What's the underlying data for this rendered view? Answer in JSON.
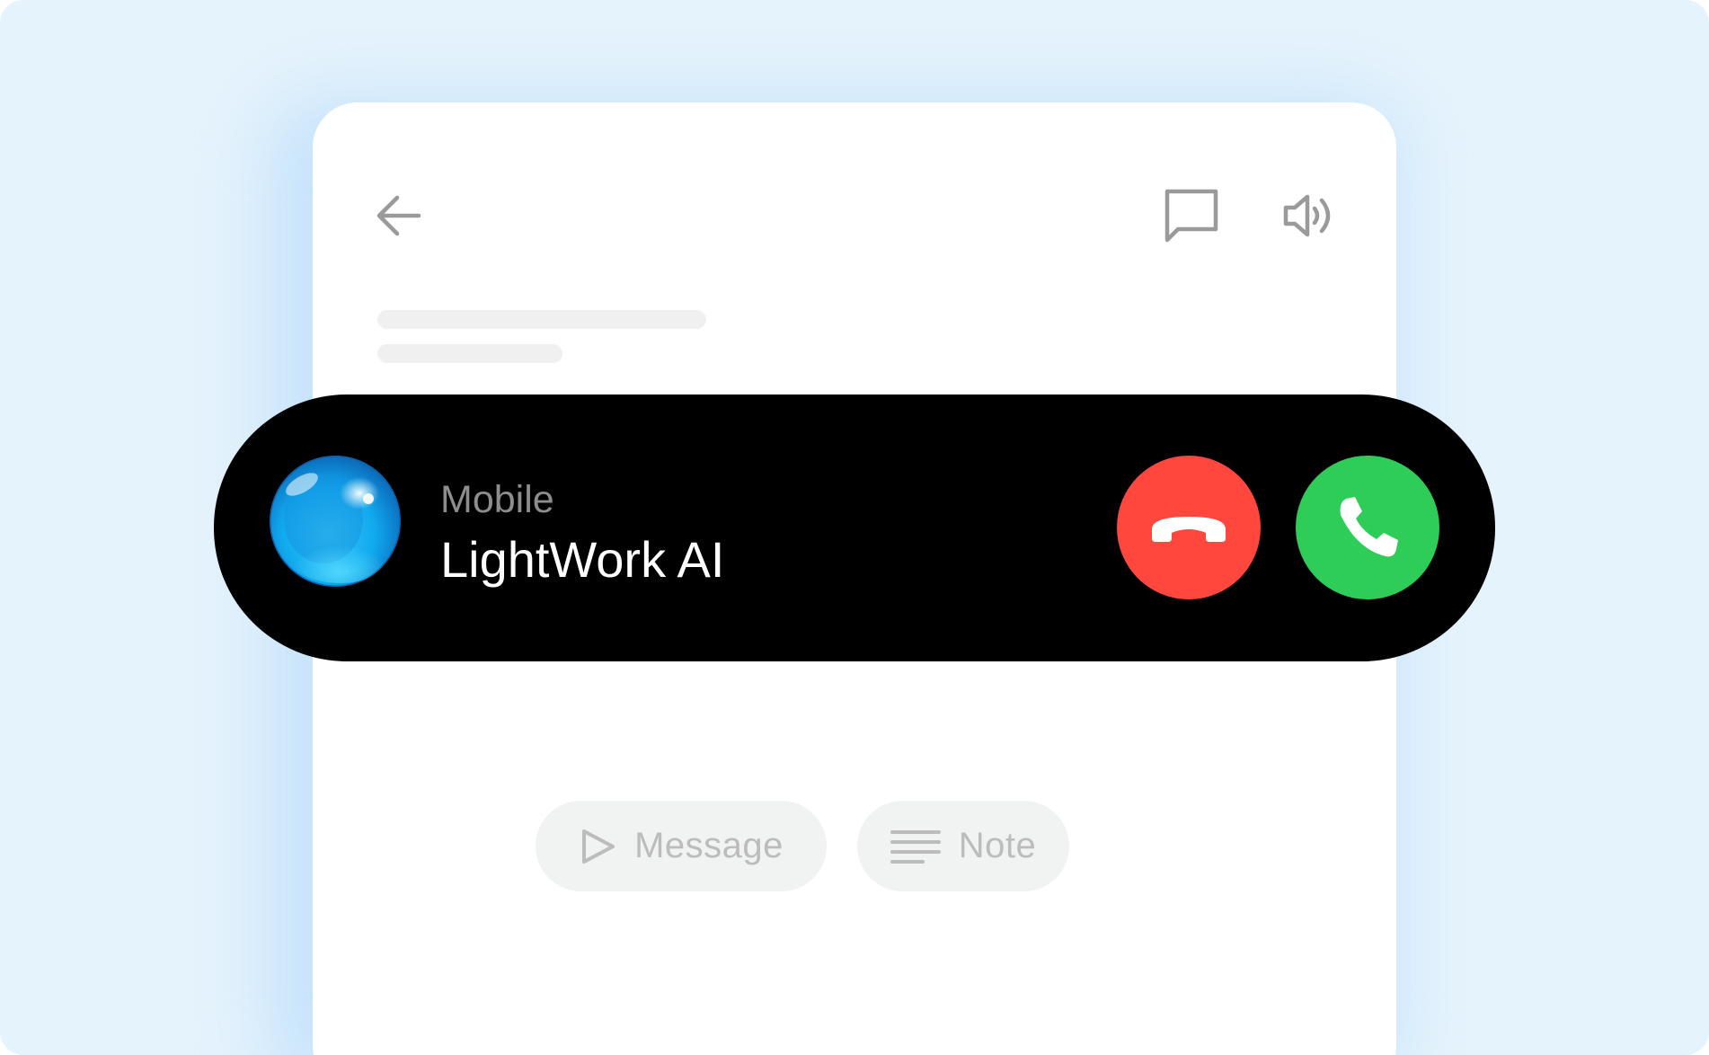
{
  "header": {
    "back_icon": "arrow-left-icon",
    "chat_icon": "chat-bubble-icon",
    "speaker_icon": "speaker-icon"
  },
  "incoming_call": {
    "line_label": "Mobile",
    "caller_name": "LightWork AI",
    "avatar_icon": "blue-orb-avatar",
    "decline_icon": "phone-hangup-icon",
    "accept_icon": "phone-answer-icon",
    "decline_color": "#ff473d",
    "accept_color": "#2dcd57"
  },
  "actions": {
    "message_label": "Message",
    "message_icon": "send-icon",
    "note_label": "Note",
    "note_icon": "notes-lines-icon"
  },
  "colors": {
    "background": "#e5f3fc",
    "card": "#ffffff",
    "call_bar": "#000000",
    "muted_icon": "#9a9a9a",
    "pill": "#f1f2f2"
  }
}
